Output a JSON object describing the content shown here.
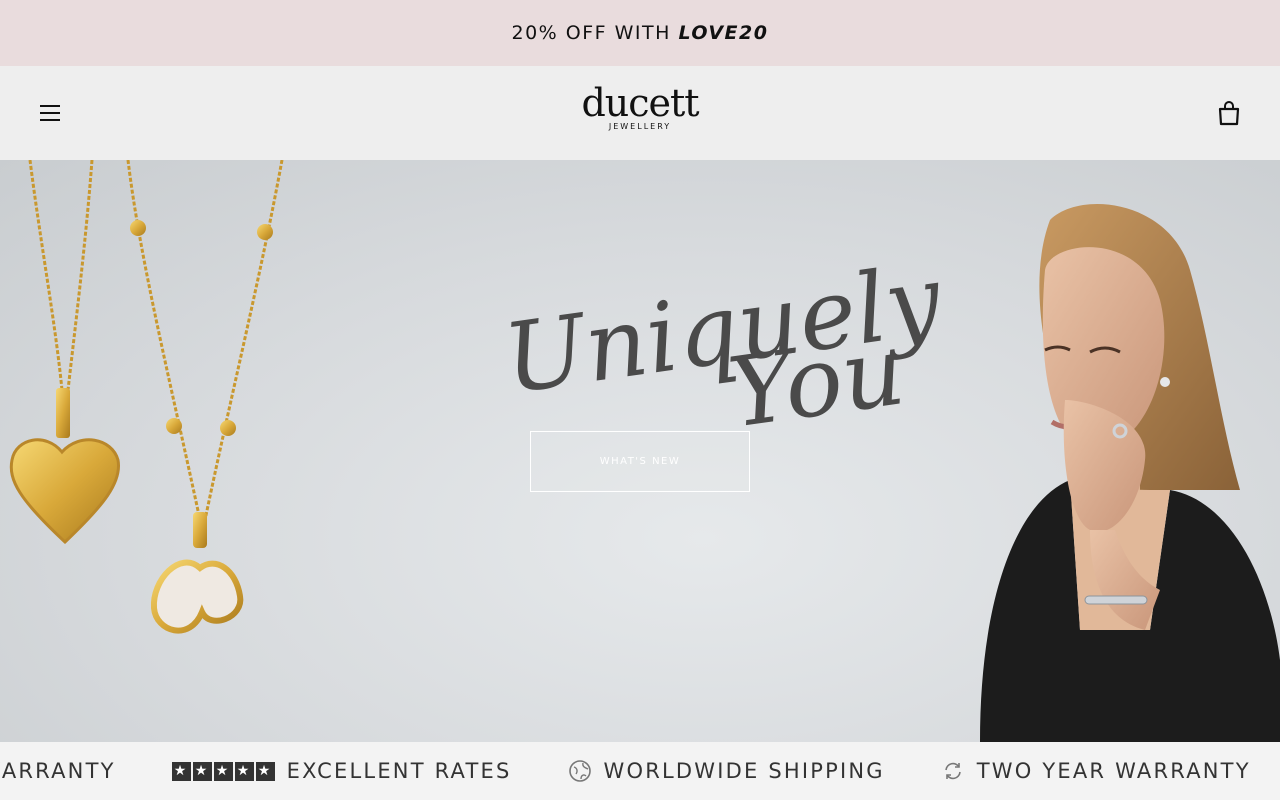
{
  "announcement": {
    "text": "20% OFF WITH ",
    "code": "LOVE20"
  },
  "header": {
    "logo_word": "ducett",
    "logo_sub": "JEWELLERY"
  },
  "hero": {
    "script_line_1": "Uniquely",
    "script_line_2": "You",
    "cta_label": "WHAT'S NEW"
  },
  "ticker": {
    "items": [
      {
        "icon": "refresh-icon",
        "label": "WARRANTY"
      },
      {
        "icon": "stars-icon",
        "label": "EXCELLENT RATES"
      },
      {
        "icon": "globe-icon",
        "label": "WORLDWIDE SHIPPING"
      },
      {
        "icon": "refresh-icon",
        "label": "TWO YEAR WARRANTY"
      }
    ]
  },
  "colors": {
    "announcement_bg": "#e9dcdd",
    "header_bg": "#eeeeee",
    "ticker_bg": "#f3f3f3",
    "gold": "#d9a93a"
  }
}
